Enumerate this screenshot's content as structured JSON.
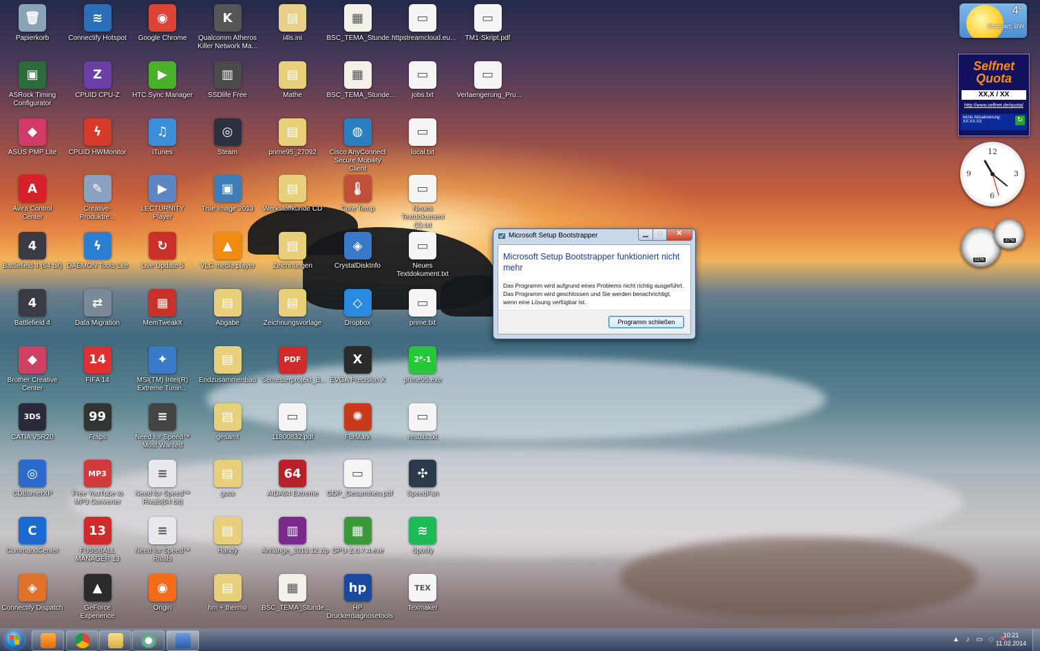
{
  "desktop": {
    "icons": [
      {
        "label": "Papierkorb",
        "col": 0,
        "row": 0,
        "color": "#8aa3b8",
        "glyph": "🗑"
      },
      {
        "label": "Connectify Hotspot",
        "col": 1,
        "row": 0,
        "color": "#2a6fb8",
        "glyph": "≋"
      },
      {
        "label": "Google Chrome",
        "col": 2,
        "row": 0,
        "color": "#db4437",
        "glyph": "◉"
      },
      {
        "label": "Qualcomm Atheros Killer Network Ma...",
        "col": 3,
        "row": 0,
        "color": "#555555",
        "glyph": "K"
      },
      {
        "label": "i4ls.ini",
        "col": 4,
        "row": 0,
        "color": "#e8d08a",
        "glyph": "▤"
      },
      {
        "label": "BSC_TEMA_Stunde...",
        "col": 5,
        "row": 0,
        "color": "#f4f1e8",
        "glyph": "▦"
      },
      {
        "label": "httpstreamcloud.eu...",
        "col": 6,
        "row": 0,
        "color": "#f5f5f5",
        "glyph": "▭"
      },
      {
        "label": "TM1-Skript.pdf",
        "col": 7,
        "row": 0,
        "color": "#f5f5f5",
        "glyph": "▭"
      },
      {
        "label": "ASRock Timing Configurator",
        "col": 0,
        "row": 1,
        "color": "#2c6b3a",
        "glyph": "▣"
      },
      {
        "label": "CPUID CPU-Z",
        "col": 1,
        "row": 1,
        "color": "#6a3fa8",
        "glyph": "Z"
      },
      {
        "label": "HTC Sync Manager",
        "col": 2,
        "row": 1,
        "color": "#4bb02a",
        "glyph": "▶"
      },
      {
        "label": "SSDlife Free",
        "col": 3,
        "row": 1,
        "color": "#4a4a4a",
        "glyph": "▥"
      },
      {
        "label": "Mathe",
        "col": 4,
        "row": 1,
        "color": "#e8cf7a",
        "glyph": "▤"
      },
      {
        "label": "BSC_TEMA_Stunde...",
        "col": 5,
        "row": 1,
        "color": "#f4f1e8",
        "glyph": "▦"
      },
      {
        "label": "jobs.txt",
        "col": 6,
        "row": 1,
        "color": "#f5f5f5",
        "glyph": "▭"
      },
      {
        "label": "Verlaengerung_Pru...",
        "col": 7,
        "row": 1,
        "color": "#f5f5f5",
        "glyph": "▭"
      },
      {
        "label": "ASUS PMP Lite",
        "col": 0,
        "row": 2,
        "color": "#d23a6a",
        "glyph": "◆"
      },
      {
        "label": "CPUID HWMonitor",
        "col": 1,
        "row": 2,
        "color": "#d63a2a",
        "glyph": "ϟ"
      },
      {
        "label": "iTunes",
        "col": 2,
        "row": 2,
        "color": "#3a8fd8",
        "glyph": "♫"
      },
      {
        "label": "Steam",
        "col": 3,
        "row": 2,
        "color": "#2a3140",
        "glyph": "◎"
      },
      {
        "label": "prime95_27092",
        "col": 4,
        "row": 2,
        "color": "#e8cf7a",
        "glyph": "▤"
      },
      {
        "label": "Cisco AnyConnect Secure Mobility Client",
        "col": 5,
        "row": 2,
        "color": "#2a7fc2",
        "glyph": "◍"
      },
      {
        "label": "local.txt",
        "col": 6,
        "row": 2,
        "color": "#f5f5f5",
        "glyph": "▭"
      },
      {
        "label": "Avira Control Center",
        "col": 0,
        "row": 3,
        "color": "#d8202a",
        "glyph": "A"
      },
      {
        "label": "Creative-Produktre...",
        "col": 1,
        "row": 3,
        "color": "#8aa0c0",
        "glyph": "✎"
      },
      {
        "label": "LECTURNITY Player",
        "col": 2,
        "row": 3,
        "color": "#5f86c2",
        "glyph": "▶"
      },
      {
        "label": "True Image 2013",
        "col": 3,
        "row": 3,
        "color": "#3f7fb8",
        "glyph": "▣"
      },
      {
        "label": "Werkstoffkunde CD",
        "col": 4,
        "row": 3,
        "color": "#e8cf7a",
        "glyph": "▤"
      },
      {
        "label": "Core Temp",
        "col": 5,
        "row": 3,
        "color": "#c0503a",
        "glyph": "🌡"
      },
      {
        "label": "Neues Textdokument (2).txt",
        "col": 6,
        "row": 3,
        "color": "#f5f5f5",
        "glyph": "▭"
      },
      {
        "label": "Battlefield 4 (64 bit)",
        "col": 0,
        "row": 4,
        "color": "#3a3a44",
        "glyph": "4"
      },
      {
        "label": "DAEMON Tools Lite",
        "col": 1,
        "row": 4,
        "color": "#2a7fd0",
        "glyph": "ϟ"
      },
      {
        "label": "Live Update 5",
        "col": 2,
        "row": 4,
        "color": "#c8302a",
        "glyph": "↻"
      },
      {
        "label": "VLC media player",
        "col": 3,
        "row": 4,
        "color": "#f08a10",
        "glyph": "▲"
      },
      {
        "label": "Zeichnungen",
        "col": 4,
        "row": 4,
        "color": "#e8cf7a",
        "glyph": "▤"
      },
      {
        "label": "CrystalDiskInfo",
        "col": 5,
        "row": 4,
        "color": "#3a78c8",
        "glyph": "◈"
      },
      {
        "label": "Neues Textdokument.txt",
        "col": 6,
        "row": 4,
        "color": "#f5f5f5",
        "glyph": "▭"
      },
      {
        "label": "Battlefield 4",
        "col": 0,
        "row": 5,
        "color": "#3a3a44",
        "glyph": "4"
      },
      {
        "label": "Data Migration",
        "col": 1,
        "row": 5,
        "color": "#7a8a9a",
        "glyph": "⇄"
      },
      {
        "label": "MemTweakIt",
        "col": 2,
        "row": 5,
        "color": "#c8302a",
        "glyph": "▦"
      },
      {
        "label": "Abgabe",
        "col": 3,
        "row": 5,
        "color": "#e8cf7a",
        "glyph": "▤"
      },
      {
        "label": "Zeichnungsvorlage",
        "col": 4,
        "row": 5,
        "color": "#e8cf7a",
        "glyph": "▤"
      },
      {
        "label": "Dropbox",
        "col": 5,
        "row": 5,
        "color": "#2a8ae0",
        "glyph": "◇"
      },
      {
        "label": "prime.txt",
        "col": 6,
        "row": 5,
        "color": "#f5f5f5",
        "glyph": "▭"
      },
      {
        "label": "Brother Creative Center",
        "col": 0,
        "row": 6,
        "color": "#d04060",
        "glyph": "◆"
      },
      {
        "label": "FIFA 14",
        "col": 1,
        "row": 6,
        "color": "#e03030",
        "glyph": "14"
      },
      {
        "label": "MSI(TM) Intel(R) Extreme Tunin...",
        "col": 2,
        "row": 6,
        "color": "#3a7ac8",
        "glyph": "✦"
      },
      {
        "label": "Endzusammenbau",
        "col": 3,
        "row": 6,
        "color": "#e8cf7a",
        "glyph": "▤"
      },
      {
        "label": "Semesterprojekt_B...",
        "col": 4,
        "row": 6,
        "color": "#d02a2a",
        "glyph": "PDF"
      },
      {
        "label": "EVGA Precision X",
        "col": 5,
        "row": 6,
        "color": "#2a2a2a",
        "glyph": "X"
      },
      {
        "label": "prime95.exe",
        "col": 6,
        "row": 6,
        "color": "#26c83a",
        "glyph": "2ᴾ-1"
      },
      {
        "label": "CATIA V5R20",
        "col": 0,
        "row": 7,
        "color": "#2a2a3a",
        "glyph": "3DS"
      },
      {
        "label": "Fraps",
        "col": 1,
        "row": 7,
        "color": "#333333",
        "glyph": "99"
      },
      {
        "label": "Need for Speed™ Most Wanted",
        "col": 2,
        "row": 7,
        "color": "#444444",
        "glyph": "≡"
      },
      {
        "label": "gesamt",
        "col": 3,
        "row": 7,
        "color": "#e8cf7a",
        "glyph": "▤"
      },
      {
        "label": "11800832.pdf",
        "col": 4,
        "row": 7,
        "color": "#f5f5f5",
        "glyph": "▭"
      },
      {
        "label": "FurMark",
        "col": 5,
        "row": 7,
        "color": "#c83a1a",
        "glyph": "✺"
      },
      {
        "label": "results.txt",
        "col": 6,
        "row": 7,
        "color": "#f5f5f5",
        "glyph": "▭"
      },
      {
        "label": "CDBurnerXP",
        "col": 0,
        "row": 8,
        "color": "#2a6ac8",
        "glyph": "◎"
      },
      {
        "label": "Free YouTube to MP3 Converter",
        "col": 1,
        "row": 8,
        "color": "#d03a3a",
        "glyph": "MP3"
      },
      {
        "label": "Need for Speed™ Rivals(64 bit)",
        "col": 2,
        "row": 8,
        "color": "#e8e8ee",
        "glyph": "≡"
      },
      {
        "label": "guss",
        "col": 3,
        "row": 8,
        "color": "#e8cf7a",
        "glyph": "▤"
      },
      {
        "label": "AIDA64 Extreme",
        "col": 4,
        "row": 8,
        "color": "#b8202a",
        "glyph": "64"
      },
      {
        "label": "GDP_Gesamtneu.pdf",
        "col": 5,
        "row": 8,
        "color": "#f5f5f5",
        "glyph": "▭"
      },
      {
        "label": "SpeedFan",
        "col": 6,
        "row": 8,
        "color": "#2a3a4a",
        "glyph": "✣"
      },
      {
        "label": "CommandCenter",
        "col": 0,
        "row": 9,
        "color": "#1a6ad0",
        "glyph": "C"
      },
      {
        "label": "FUSSBALL MANAGER 13",
        "col": 1,
        "row": 9,
        "color": "#d02a2a",
        "glyph": "13"
      },
      {
        "label": "Need for Speed™ Rivals",
        "col": 2,
        "row": 9,
        "color": "#e8e8ee",
        "glyph": "≡"
      },
      {
        "label": "Handy",
        "col": 3,
        "row": 9,
        "color": "#e8cf7a",
        "glyph": "▤"
      },
      {
        "label": "Anhänge_2013.12.zip",
        "col": 4,
        "row": 9,
        "color": "#7a2a8a",
        "glyph": "▥"
      },
      {
        "label": "GPU-Z.0.7.4.exe",
        "col": 5,
        "row": 9,
        "color": "#3a9a3a",
        "glyph": "▦"
      },
      {
        "label": "Spotify",
        "col": 6,
        "row": 9,
        "color": "#1db954",
        "glyph": "≋"
      },
      {
        "label": "Connectify Dispatch",
        "col": 0,
        "row": 10,
        "color": "#e0702a",
        "glyph": "◈"
      },
      {
        "label": "GeForce Experience",
        "col": 1,
        "row": 10,
        "color": "#2a2a2a",
        "glyph": "▲"
      },
      {
        "label": "Origin",
        "col": 2,
        "row": 10,
        "color": "#f26a1a",
        "glyph": "◉"
      },
      {
        "label": "hm + thermo",
        "col": 3,
        "row": 10,
        "color": "#e8cf7a",
        "glyph": "▤"
      },
      {
        "label": "BSC_TEMA_Stunde...",
        "col": 4,
        "row": 10,
        "color": "#f4f1e8",
        "glyph": "▦"
      },
      {
        "label": "HP Druckerdiagnosetools",
        "col": 5,
        "row": 10,
        "color": "#1a4aa0",
        "glyph": "hp"
      },
      {
        "label": "Texmaker",
        "col": 6,
        "row": 10,
        "color": "#f5f5f5",
        "glyph": "TEX"
      }
    ]
  },
  "gadgets": {
    "weather": {
      "temp": "4°",
      "city": "Stuttgart, BW"
    },
    "quota": {
      "title": "Selfnet Quota",
      "value": "XX,X / XX",
      "link": "http://www.selfnet.de/quota/",
      "update_label": "letzte Aktualisierung:",
      "update_value": "XX:XX:XX"
    },
    "cpu_meter": {
      "left": "01%",
      "right": "37%"
    }
  },
  "dialog": {
    "title": "Microsoft Setup Bootstrapper",
    "heading": "Microsoft Setup Bootstrapper funktioniert nicht mehr",
    "message": "Das Programm wird aufgrund eines Problems nicht richtig ausgeführt. Das Programm wird geschlossen und Sie werden benachrichtigt, wenn eine Lösung verfügbar ist.",
    "button": "Programm schließen",
    "min": "▁",
    "max": "□",
    "close": "✕"
  },
  "taskbar": {
    "time": "10:21",
    "date": "11.02.2014"
  }
}
